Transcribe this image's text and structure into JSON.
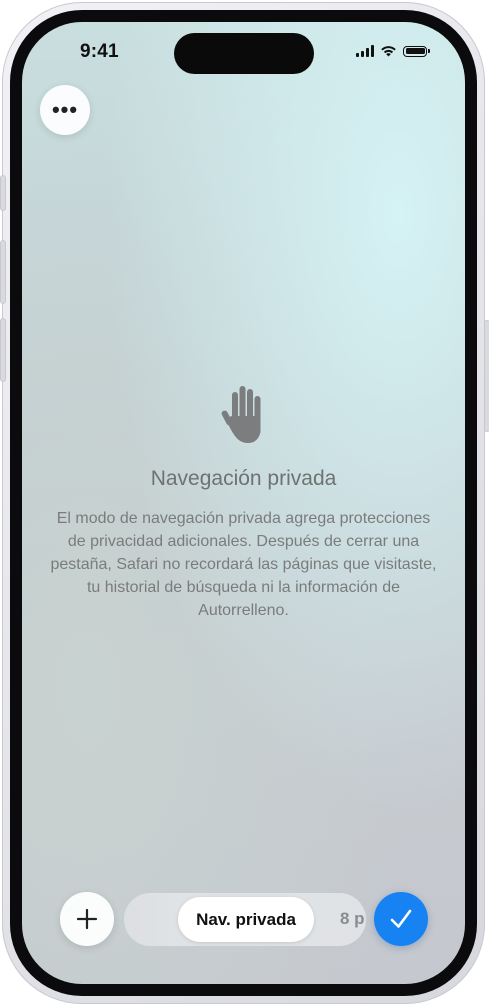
{
  "status_bar": {
    "time": "9:41",
    "icons": [
      "cellular-signal-icon",
      "wifi-icon",
      "battery-icon"
    ]
  },
  "top_left_button": {
    "icon": "ellipsis-icon",
    "glyph": "•••"
  },
  "empty_state": {
    "icon": "raised-hand-icon",
    "title": "Navegación privada",
    "description": "El modo de navegación privada agrega protecciones de privacidad adicionales. Después de cerrar una pestaña, Safari no recordará las páginas que visitaste, tu historial de búsqueda ni la información de Autorrelleno."
  },
  "toolbar": {
    "add_icon": "plus-icon",
    "tab_groups": [
      {
        "label": "Nav. privada",
        "selected": true
      },
      {
        "label": "8 p",
        "selected": false
      }
    ],
    "done_icon": "checkmark-icon"
  },
  "colors": {
    "accent": "#1783f2",
    "title_text": "#6f7272",
    "body_text": "#7a7c7c"
  }
}
